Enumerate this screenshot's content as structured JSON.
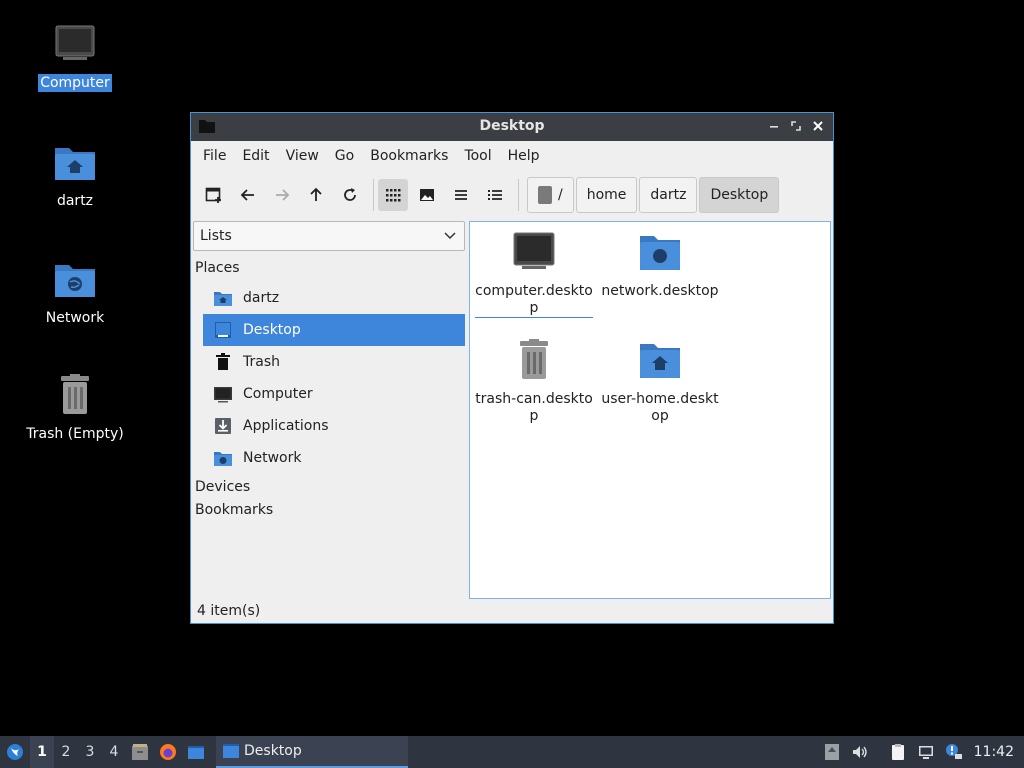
{
  "desktop": {
    "icons": [
      {
        "label": "Computer",
        "icon": "computer-icon",
        "selected": true
      },
      {
        "label": "dartz",
        "icon": "home-folder-icon"
      },
      {
        "label": "Network",
        "icon": "network-folder-icon"
      },
      {
        "label": "Trash (Empty)",
        "icon": "trash-icon"
      }
    ]
  },
  "window": {
    "title": "Desktop",
    "menu": [
      "File",
      "Edit",
      "View",
      "Go",
      "Bookmarks",
      "Tool",
      "Help"
    ],
    "path": {
      "root": "/",
      "segments": [
        "home",
        "dartz",
        "Desktop"
      ]
    },
    "sidebar": {
      "combo_value": "Lists",
      "places_header": "Places",
      "places": [
        {
          "label": "dartz",
          "icon": "home-folder-icon"
        },
        {
          "label": "Desktop",
          "icon": "desktop-icon",
          "selected": true
        },
        {
          "label": "Trash",
          "icon": "trash-icon"
        },
        {
          "label": "Computer",
          "icon": "computer-icon"
        },
        {
          "label": "Applications",
          "icon": "applications-icon"
        },
        {
          "label": "Network",
          "icon": "network-folder-icon"
        }
      ],
      "devices_header": "Devices",
      "bookmarks_header": "Bookmarks"
    },
    "files": [
      {
        "name": "computer.desktop",
        "icon": "computer-icon",
        "focused": true
      },
      {
        "name": "network.desktop",
        "icon": "network-folder-icon"
      },
      {
        "name": "trash-can.desktop",
        "icon": "trash-icon"
      },
      {
        "name": "user-home.desktop",
        "icon": "home-folder-icon"
      }
    ],
    "status": "4 item(s)"
  },
  "taskbar": {
    "workspaces": [
      "1",
      "2",
      "3",
      "4"
    ],
    "active_workspace": "1",
    "task_label": "Desktop",
    "clock": "11:42"
  },
  "colors": {
    "accent": "#3d86db",
    "folder": "#4a8fdc",
    "taskbar": "#2e3440"
  }
}
